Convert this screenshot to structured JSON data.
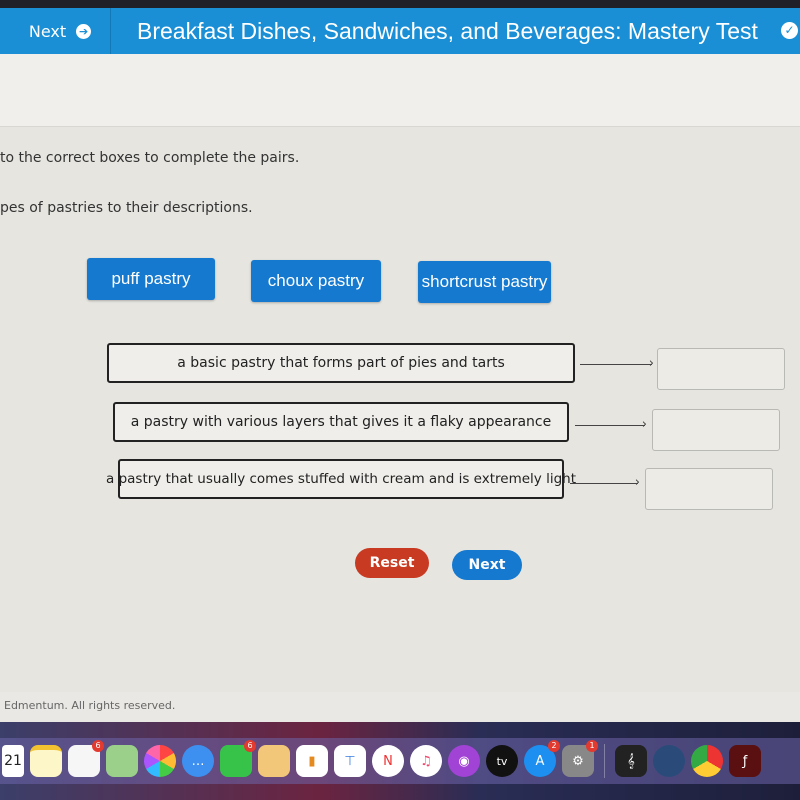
{
  "header": {
    "next_label": "Next",
    "title": "Breakfast Dishes, Sandwiches, and Beverages: Mastery Test"
  },
  "instructions": {
    "line1": "to the correct boxes to complete the pairs.",
    "line2": "pes of pastries to their descriptions."
  },
  "chips": [
    {
      "label": "puff pastry"
    },
    {
      "label": "choux pastry"
    },
    {
      "label": "shortcrust pastry"
    }
  ],
  "pairs": [
    {
      "description": "a basic pastry that forms part of pies and tarts",
      "answer": ""
    },
    {
      "description": "a pastry with various layers that gives it a flaky appearance",
      "answer": ""
    },
    {
      "description": "a pastry that usually comes stuffed with cream and is extremely light",
      "answer": ""
    }
  ],
  "buttons": {
    "reset": "Reset",
    "next": "Next"
  },
  "footer": {
    "copyright": "Edmentum. All rights reserved."
  },
  "dock": {
    "calendar_date": "21",
    "badges": {
      "reminders": "6",
      "facetime": "6",
      "appstore": "2",
      "settings": "1"
    },
    "tv_label": "tv"
  }
}
